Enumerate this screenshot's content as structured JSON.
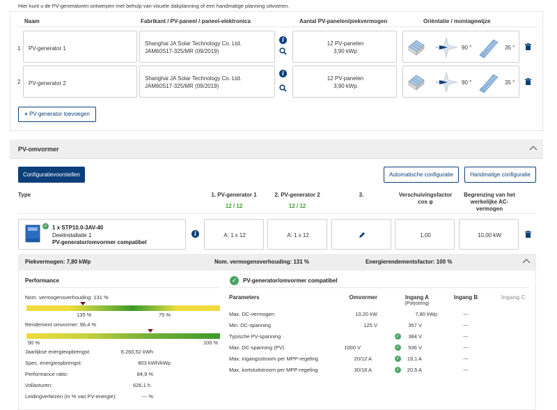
{
  "intro": "Hier kunt u de PV-generatoren ontwerpen met behulp van visuele dakplanning of een handmatige planning uitvoeren.",
  "generators": {
    "headers": {
      "name": "Naam",
      "manufacturer": "Fabrikant / PV-paneel / paneel-elektronica",
      "count": "Aantal PV-panelen/piekvermogen",
      "orientation": "Oriëntatie / montagewijze"
    },
    "rows": [
      {
        "num": "1",
        "name": "PV-generator 1",
        "manufacturer": "Shanghai JA Solar Technology Co. Ltd.",
        "panel": "JAM60S17-325/MR (09/2019)",
        "panels": "12 PV-panelen",
        "power": "3,90 kWp",
        "azimuth": "90 °",
        "tilt": "35 °"
      },
      {
        "num": "2",
        "name": "PV-generator 2",
        "manufacturer": "Shanghai JA Solar Technology Co. Ltd.",
        "panel": "JAM60S17-325/MR (09/2019)",
        "panels": "12 PV-panelen",
        "power": "3,90 kWp",
        "azimuth": "90 °",
        "tilt": "35 °"
      }
    ],
    "add_button": "PV-generator toevoegen"
  },
  "inverter": {
    "section_title": "PV-omvormer",
    "config_suggestions": "Configuratievoorstellen",
    "auto_config": "Automatische configuratie",
    "manual_config": "Handmatige configuratie",
    "headers": {
      "type": "Type",
      "gen1": "1. PV-generator 1",
      "gen1_count": "12 / 12",
      "gen2": "2. PV-generator 2",
      "gen2_count": "12 / 12",
      "gen3": "3.",
      "shift_factor": "Verschuivingsfactor cos φ",
      "limit": "Begrenzing van het werkelijke AC-vermogen"
    },
    "row": {
      "model": "1 x STP10.0-3AV-40",
      "installation": "Deelinstallatie 1",
      "compat": "PV-generator/omvormer compatibel",
      "gen1_value": "A: 1 x 12",
      "gen2_value": "A: 1 x 12",
      "cos_phi": "1,00",
      "ac_limit": "10,00 kW"
    }
  },
  "summary": {
    "peak": "Piekvermogen: 7,80 kWp",
    "ratio": "Nom. vermogensverhouding: 131 %",
    "yield_factor": "Energierendementsfactor: 100 %"
  },
  "performance": {
    "title": "Performance",
    "ratio_label": "Nom. vermogensverhouding: 131 %",
    "ratio_min": "135 %",
    "ratio_max": "75 %",
    "efficiency_label": "Rendement omvormer: 96,4 %",
    "eff_min": "90 %",
    "eff_max": "100 %",
    "stats": [
      {
        "label": "Jaarlijkse energieopbrengst:",
        "value": "6.260,52 kWh"
      },
      {
        "label": "Spec. energieopbrengst:",
        "value": "803 kWh/kWp"
      },
      {
        "label": "Performance ratio:",
        "value": "84,9 %"
      },
      {
        "label": "Vollasturen:",
        "value": "626,1 h"
      },
      {
        "label": "Leidingverliezen (in % van PV-energie):",
        "value": "--- %"
      }
    ]
  },
  "compat_table": {
    "title": "PV-generator/omvormer compatibel",
    "headers": {
      "param": "Parameters",
      "inverter": "Omvormer",
      "inA": "Ingang A",
      "inA_sub": "(Polystring)",
      "inB": "Ingang B",
      "inC": "Ingang C"
    },
    "rows": [
      {
        "param": "Max. DC-vermogen",
        "inverter": "10,20 kW",
        "inA": "7,80 kWp",
        "inB": "---",
        "check": false
      },
      {
        "param": "Min. DC-spanning",
        "inverter": "125 V",
        "inA": "357 V",
        "inB": "---",
        "check": false
      },
      {
        "param": "Typische PV-spanning",
        "inverter": "",
        "inA": "384 V",
        "inB": "---",
        "check": true
      },
      {
        "param": "Max. DC-spanning (PV)",
        "inverter": "1000 V",
        "inA": "536 V",
        "inB": "---",
        "check": true
      },
      {
        "param": "Max. ingangsstroom per MPP-regeling",
        "inverter": "20/12 A",
        "inA": "19,1 A",
        "inB": "---",
        "check": true
      },
      {
        "param": "Max. kortsluitstroom per MPP-regeling",
        "inverter": "30/18 A",
        "inA": "20,5 A",
        "inB": "---",
        "check": true
      }
    ]
  },
  "colors": {
    "brand": "#0b3f7a",
    "ok": "#4aa564",
    "bar_yellow": "#f0dc3c",
    "bar_green": "#3b9a2a",
    "marker": "#7a1020"
  }
}
